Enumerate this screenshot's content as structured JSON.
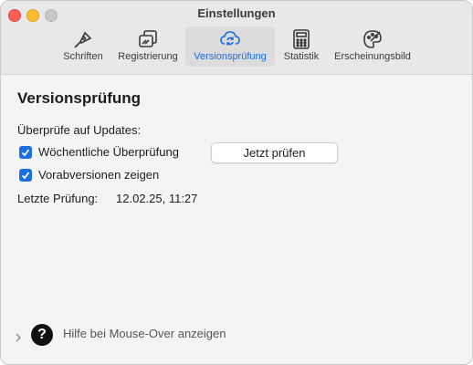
{
  "window": {
    "title": "Einstellungen"
  },
  "toolbar": {
    "tabs": [
      {
        "label": "Schriften",
        "icon": "pen-nib-icon",
        "active": false
      },
      {
        "label": "Registrierung",
        "icon": "registration-icon",
        "active": false
      },
      {
        "label": "Versionsprüfung",
        "icon": "cloud-sync-icon",
        "active": true
      },
      {
        "label": "Statistik",
        "icon": "calculator-icon",
        "active": false
      },
      {
        "label": "Erscheinungsbild",
        "icon": "palette-icon",
        "active": false
      }
    ]
  },
  "main": {
    "heading": "Versionsprüfung",
    "check_label": "Überprüfe auf Updates:",
    "weekly": {
      "label": "Wöchentliche Überprüfung",
      "checked": true
    },
    "check_now_button": "Jetzt prüfen",
    "prerelease": {
      "label": "Vorabversionen zeigen",
      "checked": true
    },
    "last_check_label": "Letzte Prüfung:",
    "last_check_value": "12.02.25, 11:27"
  },
  "footer": {
    "help_label": "Hilfe bei Mouse-Over anzeigen",
    "help_glyph": "?"
  },
  "colors": {
    "accent": "#1a6ee6",
    "close": "#ff5f57",
    "minimize": "#febc2e",
    "zoom": "#c8c8c8"
  }
}
